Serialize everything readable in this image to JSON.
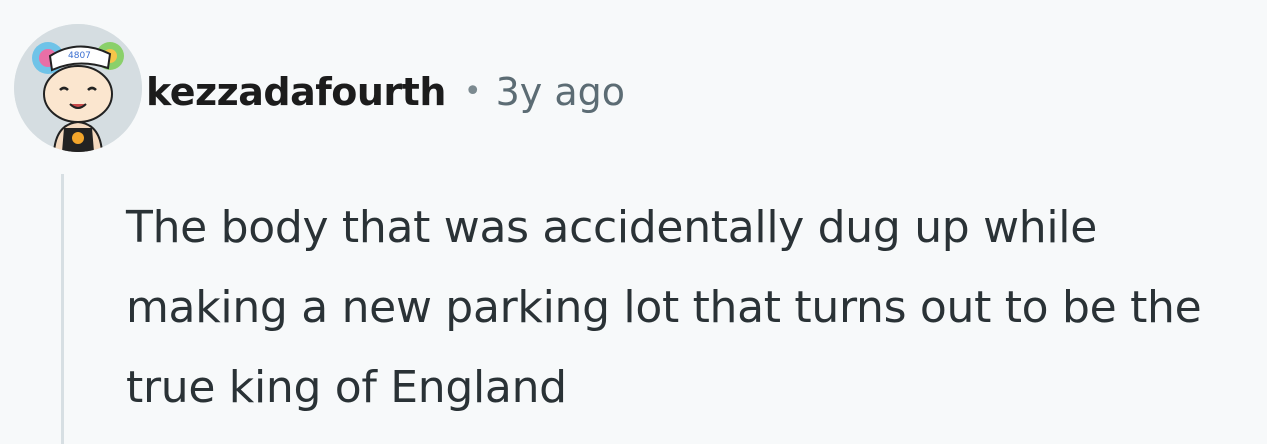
{
  "comment": {
    "author": "kezzadafourth",
    "separator": "•",
    "timestamp": "3y ago",
    "body": "The body that was accidentally dug up while making a new parking lot that turns out to be the true king of England",
    "avatar_icon": "snoo-avatar-icon"
  },
  "colors": {
    "background": "#f7f9fa",
    "author": "#1c1c1c",
    "meta": "#5c6c74",
    "body": "#2a3236",
    "thread_line": "#d7dfe3"
  }
}
